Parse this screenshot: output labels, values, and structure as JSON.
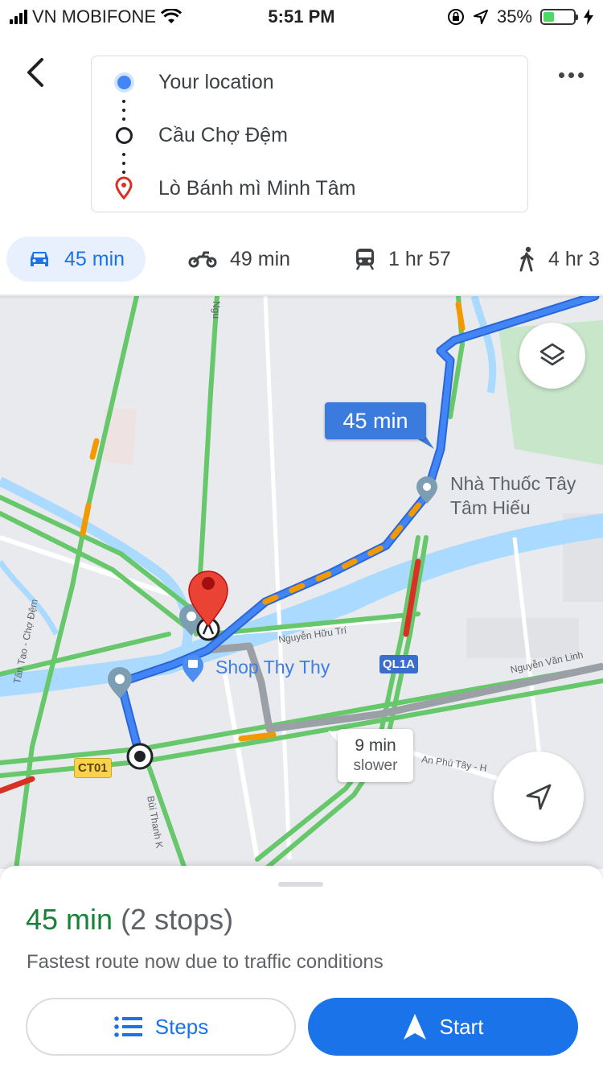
{
  "status_bar": {
    "carrier": "VN MOBIFONE",
    "time": "5:51 PM",
    "battery": "35%",
    "battery_level": 0.35
  },
  "route": {
    "origin": "Your location",
    "stop": "Cầu Chợ Đệm",
    "destination": "Lò Bánh mì Minh Tâm"
  },
  "modes": [
    {
      "icon": "car-icon",
      "label": "45 min",
      "active": true
    },
    {
      "icon": "motorbike-icon",
      "label": "49 min",
      "active": false
    },
    {
      "icon": "train-icon",
      "label": "1 hr 57",
      "active": false
    },
    {
      "icon": "walk-icon",
      "label": "4 hr 3",
      "active": false
    }
  ],
  "map": {
    "route_time": "45 min",
    "alt_route": {
      "time": "9 min",
      "note": "slower"
    },
    "places": {
      "pharmacy_line1": "Nhà Thuốc Tây",
      "pharmacy_line2": "Tâm Hiếu",
      "shop": "Shop Thy Thy"
    },
    "roads": {
      "nguyen_huu_tri": "Nguyễn Hữu Trí",
      "nguyen_van_linh": "Nguyễn Văn Linh",
      "an_phu_tay": "An Phú Tây - H",
      "tan_tao": "Tân Tạo - Chợ Đệm",
      "bui_thanh_khiet": "Bùi Thanh K",
      "top_road": "Ngu"
    },
    "shields": {
      "ql1a": "QL1A",
      "ct01": "CT01"
    },
    "colors": {
      "route": "#4285f4",
      "alt_route": "#9aa0a6",
      "traffic_green": "#66c76b",
      "traffic_orange": "#f29900",
      "traffic_red": "#d93025",
      "water": "#aadaff",
      "park": "#c8e6c9"
    }
  },
  "summary": {
    "duration": "45 min",
    "stops": "(2 stops)",
    "description": "Fastest route now due to traffic conditions",
    "steps_label": "Steps",
    "start_label": "Start"
  }
}
